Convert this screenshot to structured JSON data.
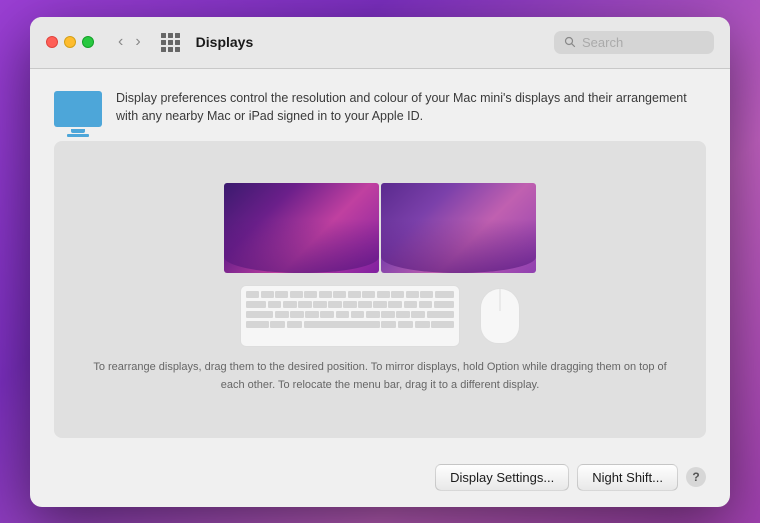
{
  "window": {
    "title": "Displays"
  },
  "titlebar": {
    "back_label": "‹",
    "forward_label": "›",
    "title": "Displays"
  },
  "search": {
    "placeholder": "Search"
  },
  "description": {
    "text": "Display preferences control the resolution and colour of your Mac mini's displays and their arrangement with any nearby Mac or iPad signed in to your Apple ID."
  },
  "instructions": {
    "text": "To rearrange displays, drag them to the desired position. To mirror displays, hold Option while dragging them on top of each other. To relocate the menu bar, drag it to a different display."
  },
  "buttons": {
    "display_settings": "Display Settings...",
    "night_shift": "Night Shift...",
    "help": "?"
  }
}
